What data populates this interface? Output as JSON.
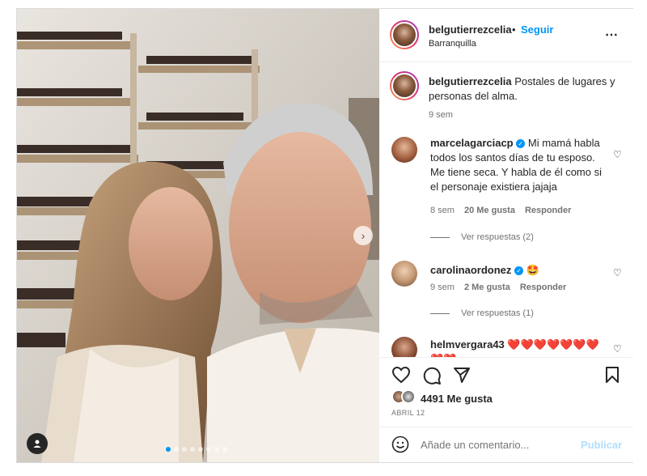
{
  "post": {
    "username": "belgutierrezcelia",
    "follow_label": "Seguir",
    "separator": "•",
    "location": "Barranquilla",
    "more_icon": "⋯",
    "caption_text": "Postales de lugares y personas del alma.",
    "caption_time": "9 sem",
    "likes": "4491 Me gusta",
    "date": "ABRIL 12",
    "carousel_dots": 8,
    "carousel_active": 0
  },
  "comments": [
    {
      "username": "marcelagarciacp",
      "verified": true,
      "text": "Mi mamá habla todos los santos días de tu esposo. Me tiene seca. Y habla de él como si el personaje existiera jajaja",
      "time": "8 sem",
      "likes": "20 Me gusta",
      "reply": "Responder",
      "view_replies": "Ver respuestas (2)"
    },
    {
      "username": "carolinaordonez",
      "verified": true,
      "text": "🤩",
      "time": "9 sem",
      "likes": "2 Me gusta",
      "reply": "Responder",
      "view_replies": "Ver respuestas (1)"
    },
    {
      "username": "helmvergara43",
      "verified": false,
      "text": "❤️❤️❤️❤️❤️❤️❤️❤️❤️"
    }
  ],
  "add_comment": {
    "placeholder": "Añade un comentario...",
    "publish_label": "Publicar"
  },
  "colors": {
    "accent": "#0095f6",
    "muted": "#737373",
    "heart": "#ed4956"
  },
  "icons": [
    "heart-icon",
    "comment-icon",
    "share-icon",
    "bookmark-icon",
    "smile-icon",
    "more-icon",
    "chevron-right-icon",
    "user-tag-icon"
  ]
}
